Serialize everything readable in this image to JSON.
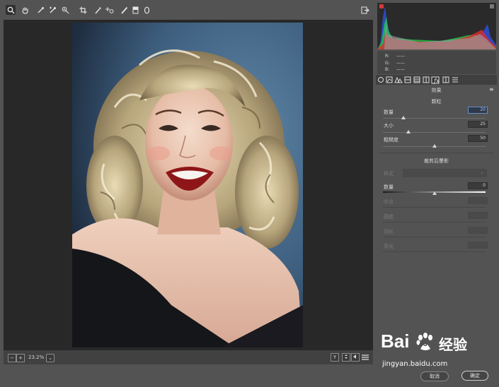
{
  "toolbar": {
    "tools": [
      {
        "name": "zoom-tool",
        "glyph": "⌕"
      },
      {
        "name": "hand-tool",
        "glyph": "✋"
      },
      {
        "name": "white-balance-tool",
        "glyph": "⁄"
      },
      {
        "name": "color-sampler-tool",
        "glyph": "⁄"
      },
      {
        "name": "targeted-adjustment-tool",
        "glyph": "◎"
      },
      {
        "name": "crop-tool",
        "glyph": "⌗"
      },
      {
        "name": "spot-removal-tool",
        "glyph": "⁄"
      },
      {
        "name": "red-eye-tool",
        "glyph": "+"
      },
      {
        "name": "adjustment-brush-tool",
        "glyph": "/"
      },
      {
        "name": "graduated-filter-tool",
        "glyph": "▮"
      },
      {
        "name": "radial-filter-tool",
        "glyph": "0"
      }
    ],
    "export_glyph": "⇥"
  },
  "statusbar": {
    "zoom_minus": "−",
    "zoom_plus": "+",
    "zoom_level": "23.2%",
    "zoom_dropdown": "⌄",
    "before_after": "Y"
  },
  "histogram": {
    "r_label": "R:",
    "r_value": "——",
    "g_label": "G:",
    "g_value": "——",
    "b_label": "B:",
    "b_value": "——"
  },
  "panel": {
    "menu_glyph": "≡",
    "title": "效果",
    "grain": {
      "heading": "颗粒",
      "amount": {
        "label": "数量",
        "value": "20",
        "level": 0.2
      },
      "size": {
        "label": "大小",
        "value": "25",
        "level": 0.25
      },
      "roughness": {
        "label": "粗糙度",
        "value": "50",
        "level": 0.5
      }
    },
    "vignette": {
      "heading": "裁剪后暈影",
      "style_label": "样式",
      "style_value": "",
      "amount": {
        "label": "数量",
        "value": "0",
        "level": 0.5
      },
      "midpoint": {
        "label": "中点"
      },
      "roundness": {
        "label": "圆度"
      },
      "feather": {
        "label": "羽化"
      },
      "highlights": {
        "label": "高光"
      }
    }
  },
  "footer": {
    "cancel": "取消",
    "ok": "确定"
  },
  "watermark": {
    "brand": "Bai",
    "paw": "du",
    "cn": "经验",
    "url": "jingyan.baidu.com"
  }
}
